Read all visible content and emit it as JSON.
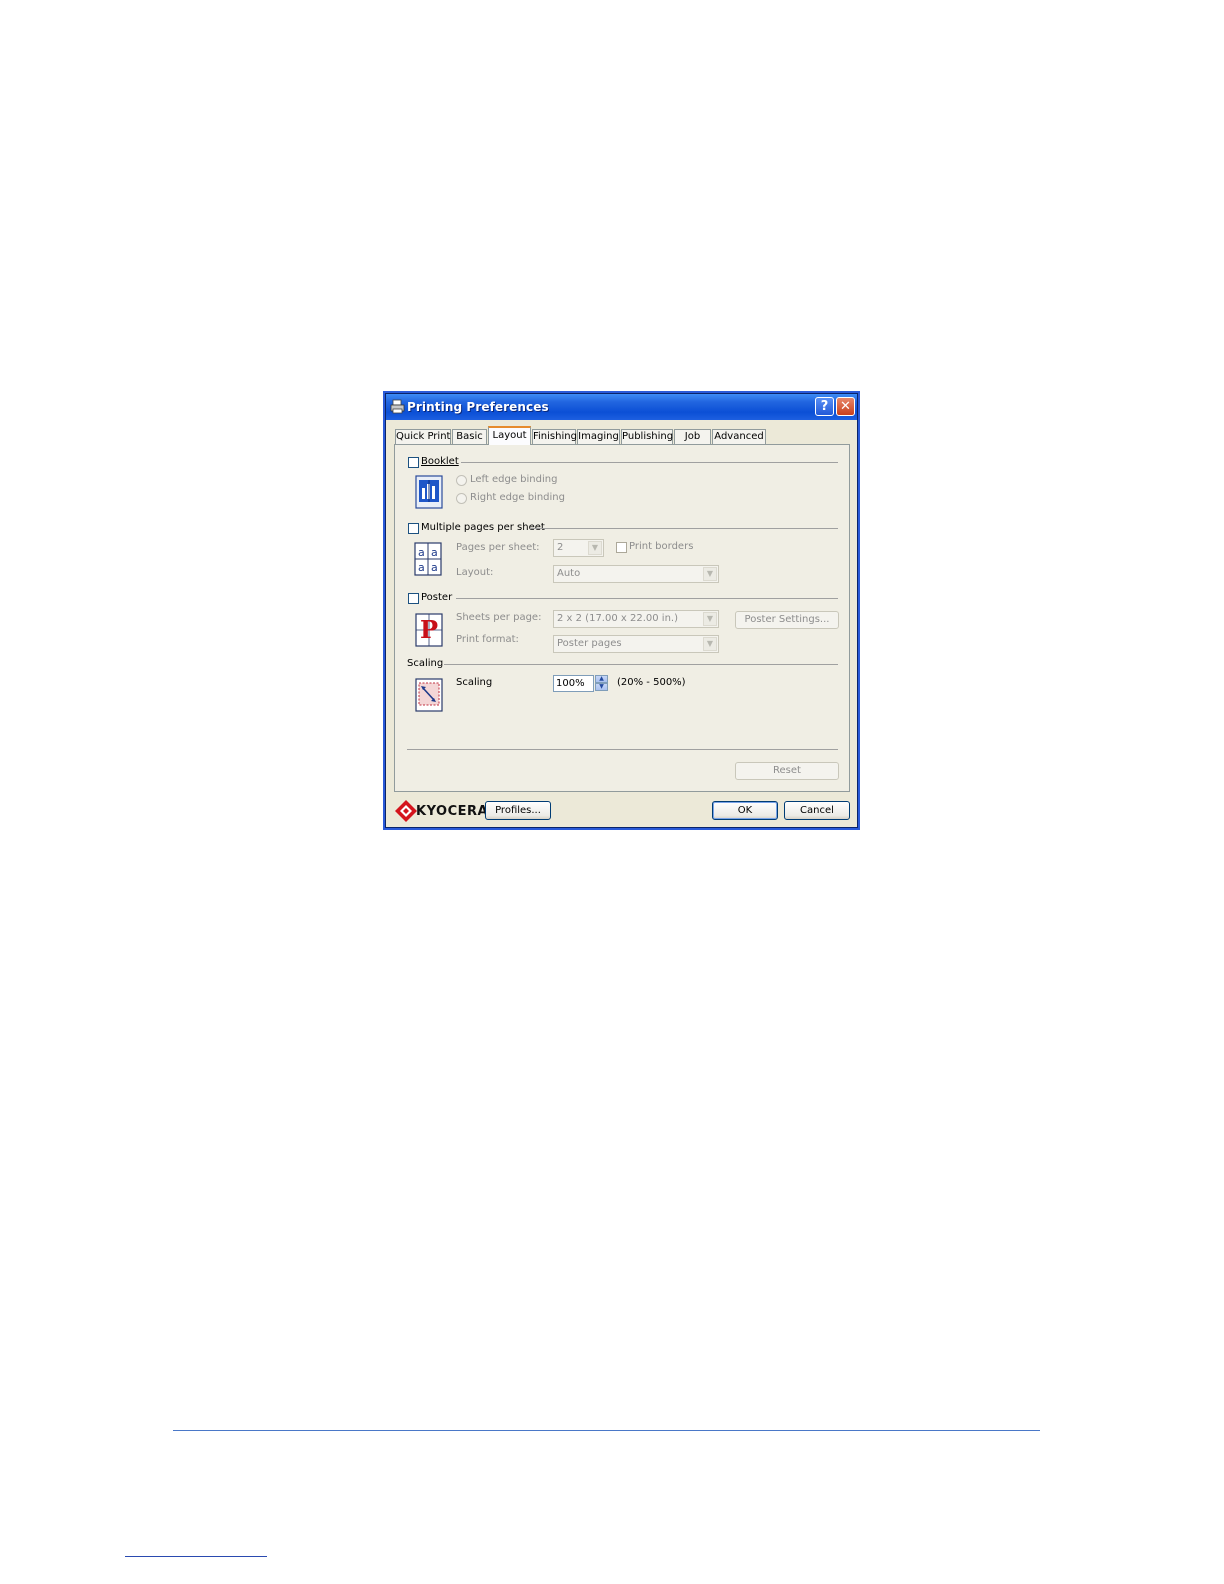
{
  "window": {
    "title": "Printing Preferences",
    "help_glyph": "?",
    "close_glyph": "✕"
  },
  "tabs": [
    {
      "label": "Quick Print"
    },
    {
      "label": "Basic"
    },
    {
      "label": "Layout",
      "active": true
    },
    {
      "label": "Finishing"
    },
    {
      "label": "Imaging"
    },
    {
      "label": "Publishing"
    },
    {
      "label": "Job"
    },
    {
      "label": "Advanced"
    }
  ],
  "booklet": {
    "checkbox_label": "Booklet",
    "checked": false,
    "option_left": "Left edge binding",
    "option_right": "Right edge binding"
  },
  "multiple_pages": {
    "checkbox_label": "Multiple pages per sheet",
    "checked": false,
    "pages_per_sheet_label": "Pages per sheet:",
    "pages_per_sheet_value": "2",
    "print_borders_label": "Print borders",
    "layout_label": "Layout:",
    "layout_value": "Auto",
    "icon_glyph": "a"
  },
  "poster": {
    "checkbox_label": "Poster",
    "checked": false,
    "sheets_per_page_label": "Sheets per page:",
    "sheets_per_page_value": "2 x 2 (17.00 x 22.00 in.)",
    "print_format_label": "Print format:",
    "print_format_value": "Poster pages",
    "settings_button": "Poster Settings...",
    "icon_glyph": "P"
  },
  "scaling": {
    "group_label": "Scaling",
    "field_label": "Scaling",
    "value": "100%",
    "range_text": "(20% - 500%)"
  },
  "buttons": {
    "reset": "Reset",
    "profiles": "Profiles...",
    "ok": "OK",
    "cancel": "Cancel"
  },
  "brand": {
    "name": "KYOCERA",
    "color": "#d4141c"
  },
  "colors": {
    "titlebar": "#0b4fd6",
    "dialog_face": "#ece9d8",
    "active_tab_accent": "#e68b2c",
    "page_rule": "#4a78c8"
  }
}
